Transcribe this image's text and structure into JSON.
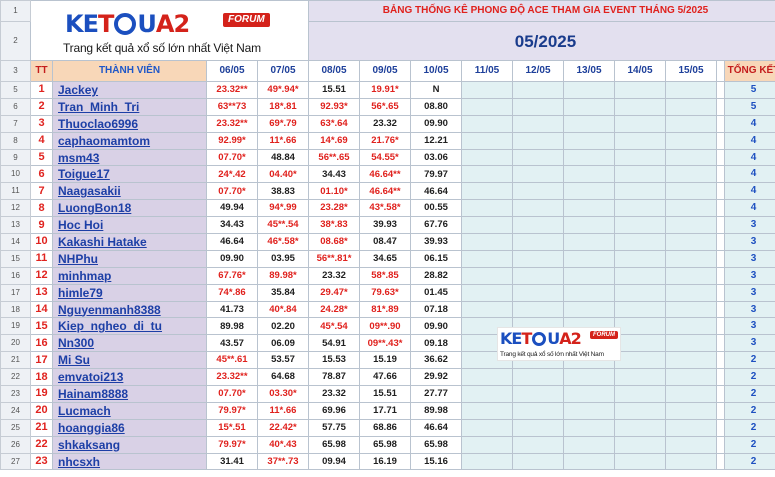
{
  "logo": {
    "brand_letters": [
      "K",
      "E",
      "T",
      "Q",
      "U",
      "A",
      "2"
    ],
    "forum_label": "FORUM",
    "tagline": "Trang kết quả xổ số lớn nhất Việt Nam"
  },
  "header": {
    "title": "BẢNG THỐNG KÊ PHONG ĐỘ ACE THAM GIA EVENT THÁNG 5/2025",
    "month": "05/2025"
  },
  "columns": {
    "tt": "TT",
    "member": "THÀNH VIÊN",
    "dates": [
      "06/05",
      "07/05",
      "08/05",
      "09/05",
      "10/05",
      "11/05",
      "12/05",
      "13/05",
      "14/05",
      "15/05"
    ],
    "total": "TỔNG KẾT"
  },
  "row_numbers": [
    "1",
    "2",
    "3",
    "5",
    "6",
    "7",
    "8",
    "9",
    "10",
    "11",
    "12",
    "13",
    "14",
    "15",
    "16",
    "17",
    "18",
    "19",
    "20",
    "21",
    "22",
    "23",
    "24",
    "25",
    "26",
    "27"
  ],
  "rows": [
    {
      "tt": "1",
      "member": "Jackey",
      "values": [
        "23.32**",
        "49*.94*",
        "15.51",
        "19.91*",
        "N"
      ],
      "red": [
        true,
        true,
        false,
        true,
        false
      ],
      "total": "5"
    },
    {
      "tt": "2",
      "member": "Tran_Minh_Tri",
      "values": [
        "63**73",
        "18*.81",
        "92.93*",
        "56*.65",
        "08.80"
      ],
      "red": [
        true,
        true,
        true,
        true,
        false
      ],
      "total": "5"
    },
    {
      "tt": "3",
      "member": "Thuoclao6996",
      "values": [
        "23.32**",
        "69*.79",
        "63*.64",
        "23.32",
        "09.90"
      ],
      "red": [
        true,
        true,
        true,
        false,
        false
      ],
      "total": "4"
    },
    {
      "tt": "4",
      "member": "caphaomamtom",
      "values": [
        "92.99*",
        "11*.66",
        "14*.69",
        "21.76*",
        "12.21"
      ],
      "red": [
        true,
        true,
        true,
        true,
        false
      ],
      "total": "4"
    },
    {
      "tt": "5",
      "member": "msm43",
      "values": [
        "07.70*",
        "48.84",
        "56**.65",
        "54.55*",
        "03.06"
      ],
      "red": [
        true,
        false,
        true,
        true,
        false
      ],
      "total": "4"
    },
    {
      "tt": "6",
      "member": "Toigue17",
      "values": [
        "24*.42",
        "04.40*",
        "34.43",
        "46.64**",
        "79.97"
      ],
      "red": [
        true,
        true,
        false,
        true,
        false
      ],
      "total": "4"
    },
    {
      "tt": "7",
      "member": "Naagasakii",
      "values": [
        "07.70*",
        "38.83",
        "01.10*",
        "46.64**",
        "46.64"
      ],
      "red": [
        true,
        false,
        true,
        true,
        false
      ],
      "total": "4"
    },
    {
      "tt": "8",
      "member": "LuongBon18",
      "values": [
        "49.94",
        "94*.99",
        "23.28*",
        "43*.58*",
        "00.55"
      ],
      "red": [
        false,
        true,
        true,
        true,
        false
      ],
      "total": "4"
    },
    {
      "tt": "9",
      "member": "Hoc Hoi",
      "values": [
        "34.43",
        "45**.54",
        "38*.83",
        "39.93",
        "67.76"
      ],
      "red": [
        false,
        true,
        true,
        false,
        false
      ],
      "total": "3"
    },
    {
      "tt": "10",
      "member": "Kakashi Hatake",
      "values": [
        "46.64",
        "46*.58*",
        "08.68*",
        "08.47",
        "39.93"
      ],
      "red": [
        false,
        true,
        true,
        false,
        false
      ],
      "total": "3"
    },
    {
      "tt": "11",
      "member": "NHPhu",
      "values": [
        "09.90",
        "03.95",
        "56**.81*",
        "34.65",
        "06.15"
      ],
      "red": [
        false,
        false,
        true,
        false,
        false
      ],
      "total": "3"
    },
    {
      "tt": "12",
      "member": "minhmap",
      "values": [
        "67.76*",
        "89.98*",
        "23.32",
        "58*.85",
        "28.82"
      ],
      "red": [
        true,
        true,
        false,
        true,
        false
      ],
      "total": "3"
    },
    {
      "tt": "13",
      "member": "himle79",
      "values": [
        "74*.86",
        "35.84",
        "29.47*",
        "79.63*",
        "01.45"
      ],
      "red": [
        true,
        false,
        true,
        true,
        false
      ],
      "total": "3"
    },
    {
      "tt": "14",
      "member": "Nguyenmanh8388",
      "values": [
        "41.73",
        "40*.84",
        "24.28*",
        "81*.89",
        "07.18"
      ],
      "red": [
        false,
        true,
        true,
        true,
        false
      ],
      "total": "3"
    },
    {
      "tt": "15",
      "member": "Kiep_ngheo_di_tu",
      "values": [
        "89.98",
        "02.20",
        "45*.54",
        "09**.90",
        "09.90"
      ],
      "red": [
        false,
        false,
        true,
        true,
        false
      ],
      "total": "3"
    },
    {
      "tt": "16",
      "member": "Nn300",
      "values": [
        "43.57",
        "06.09",
        "54.91",
        "09**.43*",
        "09.18"
      ],
      "red": [
        false,
        false,
        false,
        true,
        false
      ],
      "total": "3"
    },
    {
      "tt": "17",
      "member": "Mi Su",
      "values": [
        "45**.61",
        "53.57",
        "15.53",
        "15.19",
        "36.62"
      ],
      "red": [
        true,
        false,
        false,
        false,
        false
      ],
      "total": "2"
    },
    {
      "tt": "18",
      "member": "emvatoi213",
      "values": [
        "23.32**",
        "64.68",
        "78.87",
        "47.66",
        "29.92"
      ],
      "red": [
        true,
        false,
        false,
        false,
        false
      ],
      "total": "2"
    },
    {
      "tt": "19",
      "member": "Hainam8888",
      "values": [
        "07.70*",
        "03.30*",
        "23.32",
        "15.51",
        "27.77"
      ],
      "red": [
        true,
        true,
        false,
        false,
        false
      ],
      "total": "2"
    },
    {
      "tt": "20",
      "member": "Lucmach",
      "values": [
        "79.97*",
        "11*.66",
        "69.96",
        "17.71",
        "89.98"
      ],
      "red": [
        true,
        true,
        false,
        false,
        false
      ],
      "total": "2"
    },
    {
      "tt": "21",
      "member": "hoanggia86",
      "values": [
        "15*.51",
        "22.42*",
        "57.75",
        "68.86",
        "46.64"
      ],
      "red": [
        true,
        true,
        false,
        false,
        false
      ],
      "total": "2"
    },
    {
      "tt": "22",
      "member": "shkaksang",
      "values": [
        "79.97*",
        "40*.43",
        "65.98",
        "65.98",
        "65.98"
      ],
      "red": [
        true,
        true,
        false,
        false,
        false
      ],
      "total": "2"
    },
    {
      "tt": "23",
      "member": "nhcsxh",
      "values": [
        "31.41",
        "37**.73",
        "09.94",
        "16.19",
        "15.16"
      ],
      "red": [
        false,
        true,
        false,
        false,
        false
      ],
      "total": "2"
    }
  ],
  "colors": {
    "title_red": "#e0211d",
    "month_blue": "#1a3c8c",
    "member_bg": "#d9d1e6",
    "empty_bg": "#e2f1f3",
    "header_orange": "#f8d7b8"
  }
}
